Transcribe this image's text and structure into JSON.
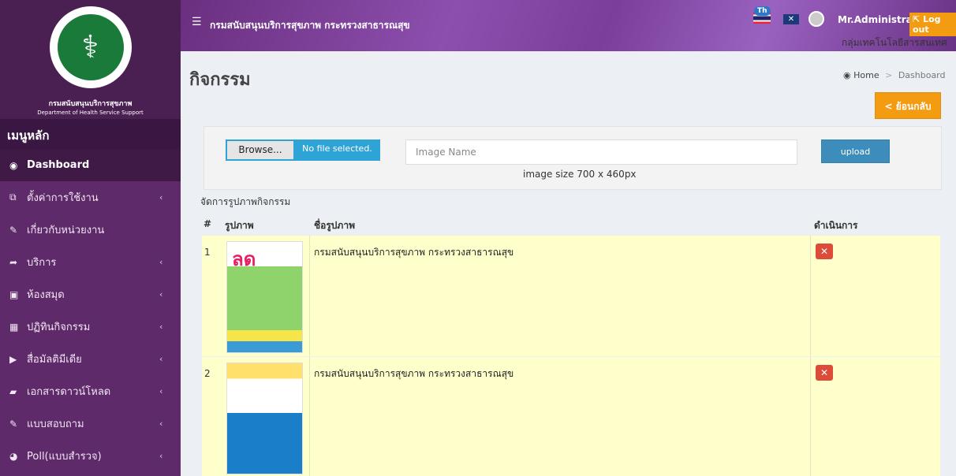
{
  "sidebar": {
    "brand_th": "กรมสนับสนุนบริการสุขภาพ",
    "brand_en": "Department of Health Service Support",
    "menu_header": "เมนูหลัก",
    "items": [
      {
        "label": "Dashboard",
        "icon": "dashboard-icon",
        "active": true
      },
      {
        "label": "ตั้งค่าการใช้งาน",
        "icon": "settings-icon"
      },
      {
        "label": "เกี่ยวกับหน่วยงาน",
        "icon": "edit-icon"
      },
      {
        "label": "บริการ",
        "icon": "share-icon"
      },
      {
        "label": "ห้องสมุด",
        "icon": "library-icon"
      },
      {
        "label": "ปฏิทินกิจกรรม",
        "icon": "calendar-icon"
      },
      {
        "label": "สื่อมัลติมีเดีย",
        "icon": "media-icon"
      },
      {
        "label": "เอกสารดาวน์โหลด",
        "icon": "book-icon"
      },
      {
        "label": "แบบสอบถาม",
        "icon": "edit-icon"
      },
      {
        "label": "Poll(แบบสำรวจ)",
        "icon": "pie-chart-icon"
      }
    ]
  },
  "header": {
    "title": "กรมสนับสนุนบริการสุขภาพ กระทรวงสาธารณสุข",
    "lang_badge": "Th",
    "username": "Mr.Administrator",
    "logout": "Log out",
    "subtitle": "กลุ่มเทคโนโลยีสารสนเทศ"
  },
  "page": {
    "title": "กิจกรรม",
    "breadcrumb": [
      "Home",
      "Dashboard"
    ],
    "back_button": "< ย้อนกลับ"
  },
  "upload": {
    "browse_label": "Browse...",
    "file_status": "No file selected.",
    "image_name_placeholder": "Image Name",
    "upload_label": "upload",
    "size_note": "image size 700 x 460px"
  },
  "table": {
    "section_label": "จัดการรูปภาพกิจกรรม",
    "headers": [
      "#",
      "รูปภาพ",
      "ชื่อรูปภาพ",
      "ดำเนินการ"
    ],
    "rows": [
      {
        "num": "1",
        "name": "กรมสนับสนุนบริการสุขภาพ กระทรวงสาธารณสุข"
      },
      {
        "num": "2",
        "name": "กรมสนับสนุนบริการสุขภาพ กระทรวงสาธารณสุข"
      }
    ]
  },
  "colors": {
    "sidebar": "#5f2a6a",
    "accent_orange": "#f39c12",
    "row_highlight": "#ffffcc",
    "delete_red": "#dd4b39"
  }
}
